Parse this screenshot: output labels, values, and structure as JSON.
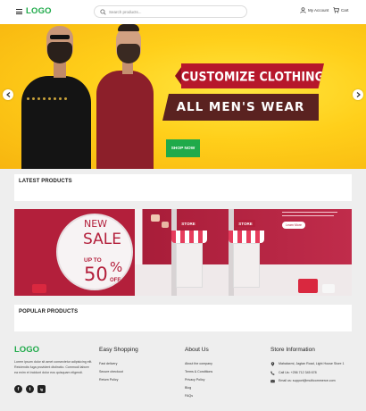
{
  "header": {
    "logo": "LOGO",
    "search_placeholder": "Search products...",
    "account_label": "My Account",
    "cart_label": "Cart"
  },
  "hero": {
    "headline": "CUSTOMIZE CLOTHING",
    "subheadline": "ALL MEN'S WEAR",
    "cta_label": "SHOP NOW"
  },
  "sections": {
    "latest_title": "LATEST PRODUCTS",
    "popular_title": "POPULAR PRODUCTS"
  },
  "promo": {
    "new": "NEW",
    "sale": "SALE",
    "upto": "UP TO",
    "percent_value": "50",
    "percent_sign": "%",
    "off": "OFF",
    "store_sign": "STORE",
    "learn_button": "Learn More"
  },
  "footer": {
    "logo": "LOGO",
    "description": "Lorem ipsum dolor sit amet consectetur adipisicing elit. Reiciendis fuga provident distinctio. Commodi labore ea enim et incidunt dolor eos quisquam eligendi.",
    "easy_shopping": {
      "title": "Easy Shopping",
      "links": [
        "Fast delivery",
        "Secure checkout",
        "Return Policy"
      ]
    },
    "about_us": {
      "title": "About Us",
      "links": [
        "About the company",
        "Terms & Conditions",
        "Privacy Policy",
        "Blog",
        "FAQs"
      ]
    },
    "store_info": {
      "title": "Store Information",
      "address": "Mahalaxmi, Jagtan Road, Light House Store 1",
      "phone": "Call Us: +256 712 345 678",
      "email": "Email us: support@multicommerce.com"
    },
    "social": [
      "f",
      "t",
      "ig"
    ]
  },
  "colors": {
    "brand_green": "#1faa4a",
    "hero_yellow": "#ffd21f",
    "banner_red": "#b6172b",
    "banner_dark": "#5a2220",
    "promo_red": "#b31f3b"
  }
}
